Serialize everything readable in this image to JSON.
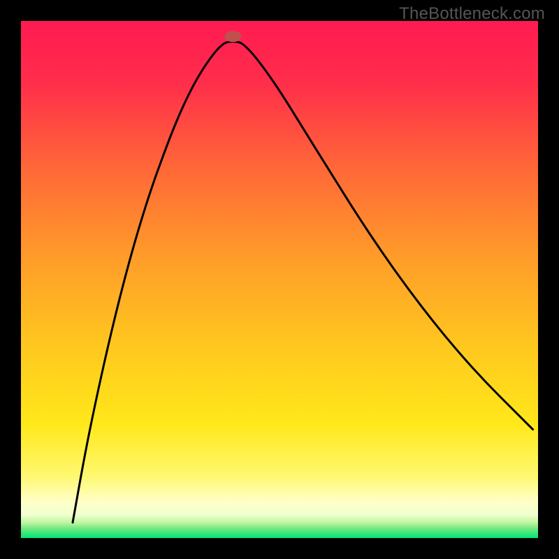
{
  "watermark": "TheBottleneck.com",
  "chart_data": {
    "type": "line",
    "title": "",
    "xlabel": "",
    "ylabel": "",
    "xlim": [
      0,
      100
    ],
    "ylim": [
      0,
      100
    ],
    "background": "gradient",
    "gradient_colors": {
      "top": "#ff1744",
      "upper": "#ff5722",
      "mid": "#ffc107",
      "lower": "#ffeb3b",
      "bottom_band": "#ffffc0",
      "thin_green": "#9ccc65",
      "base": "#00e676"
    },
    "marker": {
      "x": 41,
      "y": 97,
      "color": "#c0504d"
    },
    "curve_description": "V-shaped bottleneck curve with minimum near x=40",
    "series": [
      {
        "name": "bottleneck-curve",
        "points": [
          {
            "x": 10.0,
            "y": 3.0
          },
          {
            "x": 12.5,
            "y": 17.0
          },
          {
            "x": 15.0,
            "y": 29.0
          },
          {
            "x": 17.5,
            "y": 40.0
          },
          {
            "x": 20.0,
            "y": 50.0
          },
          {
            "x": 22.5,
            "y": 59.0
          },
          {
            "x": 25.0,
            "y": 67.0
          },
          {
            "x": 27.5,
            "y": 74.0
          },
          {
            "x": 30.0,
            "y": 80.5
          },
          {
            "x": 32.5,
            "y": 86.0
          },
          {
            "x": 35.0,
            "y": 90.5
          },
          {
            "x": 37.5,
            "y": 94.0
          },
          {
            "x": 39.0,
            "y": 95.5
          },
          {
            "x": 40.0,
            "y": 96.0
          },
          {
            "x": 42.0,
            "y": 96.0
          },
          {
            "x": 43.0,
            "y": 95.5
          },
          {
            "x": 45.0,
            "y": 93.5
          },
          {
            "x": 48.0,
            "y": 89.5
          },
          {
            "x": 51.0,
            "y": 85.0
          },
          {
            "x": 55.0,
            "y": 78.5
          },
          {
            "x": 60.0,
            "y": 70.5
          },
          {
            "x": 65.0,
            "y": 62.5
          },
          {
            "x": 70.0,
            "y": 55.0
          },
          {
            "x": 75.0,
            "y": 48.0
          },
          {
            "x": 80.0,
            "y": 41.5
          },
          {
            "x": 85.0,
            "y": 35.5
          },
          {
            "x": 90.0,
            "y": 30.0
          },
          {
            "x": 95.0,
            "y": 25.0
          },
          {
            "x": 99.0,
            "y": 21.0
          }
        ]
      }
    ]
  }
}
